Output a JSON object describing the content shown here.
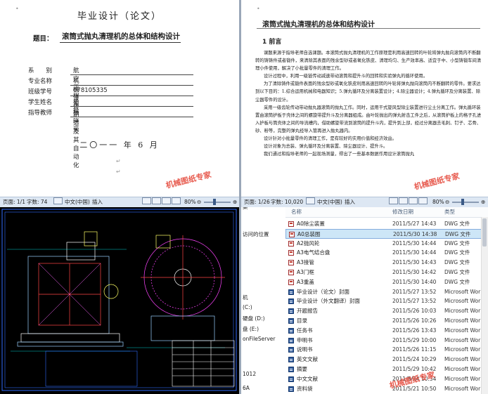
{
  "watermark": "机械图纸专家",
  "cover": {
    "title": "毕业设计（论文）",
    "topic_label": "题目：",
    "topic": "滚筒式抛丸清理机的总体和结构设计",
    "rows": [
      {
        "label": "系　　别",
        "value": "航空工程系"
      },
      {
        "label": "专业名称",
        "value": "机械设计制造及其自动化"
      },
      {
        "label": "班级学号",
        "value": "078105335"
      },
      {
        "label": "学生姓名",
        "value": "杨挺"
      },
      {
        "label": "指导教师",
        "value": "张晓荣"
      }
    ],
    "date": "二〇一一 年 6 月",
    "status": {
      "page": "页面: 1/1",
      "words": "字数: 74",
      "lang": "中文(中国)",
      "mode": "插入",
      "zoom": "80%"
    }
  },
  "doc": {
    "title": "滚筒式抛丸清理机的总体和结构设计",
    "heading": "1  前言",
    "paragraphs": [
      "课题来源于指导老师自选课题。本滚筒式抛丸清理机的工作原理是利用高速回转的叶轮将弹丸抛向滚筒内不断翻转的铸铸件或者锻件，来清除其表面的残余型砂或者氧化铁皮、清理均匀、生产效率高、适宜于中、小型铸锻车间清理小件使用，解决了小批量零件的清理工作。",
      "设计过程中，利用一级链传动减速带动滚筒和提升斗的回转和实验弹丸的循环使用。",
      "为了清除铸件或锻件表面的残余型砂或氧化铁皮利用高速回转的叶轮将弹丸抛向滚筒内不断翻转的零件。要求达到以下目的：1.综合运用机械和电器知识；5.弹丸循环及分离装置设计；4.除尘器设计；4.弹丸循环及分离装置、除尘器零件的设计。",
      "采用一级齿轮传动带动抛丸器滚筒的抛丸工作。同时，运用干式旋风型除尘装置进行尘土分离工作。弹丸循环装置由滚筒护板于壳体之间的螺旋带提升斗及分离器组成。由叶轮抛出的弹丸射击工件之后，从滚筒护板上的格子孔进入护板与筒壳体之间的导流槽内，借助螺旋带流到滚筒的提升斗内，提升到上部，经过分离器去毛刺、钉子、芯骨、砂、粉等，完整的弹丸经导入管再进入抛丸器内。",
      "设计针对小批量零件的清理工作，是有较好的实用价值和经济效益。",
      "设计对象为总装、弹丸循环及分离装置、除尘器设计、提升斗。",
      "我们通过和指导老师的一起现场测量，得出了一些基本数据作用设计滚筒抛丸"
    ],
    "status": {
      "page": "页面: 1/26",
      "words": "字数: 10,020",
      "lang": "中文(中国)",
      "mode": "插入",
      "zoom": "80%"
    }
  },
  "cad": {
    "status": {
      "page": "页面: 1/1",
      "words": "字数: 74",
      "lang": "中文(中国)",
      "mode": "插入",
      "zoom": "80%"
    }
  },
  "explorer": {
    "nav_items": [
      "集",
      "访问的位置",
      "",
      "",
      "",
      "",
      "",
      "",
      "",
      "机",
      "(C:)",
      "硬盘 (D:)",
      "盘 (E:)",
      "onFileServer",
      "",
      "1012",
      "6A"
    ],
    "columns": {
      "name": "名称",
      "date": "修改日期",
      "type": "类型"
    },
    "files": [
      {
        "name": "A0除尘装置",
        "date": "2011/5/27 14:43",
        "type": "DWG 文件",
        "icon": "dwg",
        "selected": false
      },
      {
        "name": "A0总装图",
        "date": "2011/5/30 14:38",
        "type": "DWG 文件",
        "icon": "dwg",
        "selected": true
      },
      {
        "name": "A2抛风轮",
        "date": "2011/5/30 14:44",
        "type": "DWG 文件",
        "icon": "dwg",
        "selected": false
      },
      {
        "name": "A3电气结合盘",
        "date": "2011/5/30 14:44",
        "type": "DWG 文件",
        "icon": "dwg",
        "selected": false
      },
      {
        "name": "A3接管",
        "date": "2011/5/30 14:43",
        "type": "DWG 文件",
        "icon": "dwg",
        "selected": false
      },
      {
        "name": "A3门框",
        "date": "2011/5/30 14:42",
        "type": "DWG 文件",
        "icon": "dwg",
        "selected": false
      },
      {
        "name": "A3重盖",
        "date": "2011/5/30 14:40",
        "type": "DWG 文件",
        "icon": "dwg",
        "selected": false
      },
      {
        "name": "毕业设计（论文）封面",
        "date": "2011/5/27 13:52",
        "type": "Microsoft Wor",
        "icon": "doc",
        "selected": false
      },
      {
        "name": "毕业设计（外文翻译）封面",
        "date": "2011/5/27 13:52",
        "type": "Microsoft Wor",
        "icon": "doc",
        "selected": false
      },
      {
        "name": "开题报告",
        "date": "2011/5/26 10:03",
        "type": "Microsoft Wor",
        "icon": "doc",
        "selected": false
      },
      {
        "name": "目录",
        "date": "2011/5/26 10:26",
        "type": "Microsoft Wor",
        "icon": "doc",
        "selected": false
      },
      {
        "name": "任务书",
        "date": "2011/5/26 13:43",
        "type": "Microsoft Wor",
        "icon": "doc",
        "selected": false
      },
      {
        "name": "申明书",
        "date": "2011/5/29 10:00",
        "type": "Microsoft Wor",
        "icon": "doc",
        "selected": false
      },
      {
        "name": "说明书",
        "date": "2011/5/26 11:15",
        "type": "Microsoft Wor",
        "icon": "doc",
        "selected": false
      },
      {
        "name": "英文文献",
        "date": "2011/5/24 10:29",
        "type": "Microsoft Wor",
        "icon": "doc",
        "selected": false
      },
      {
        "name": "摘要",
        "date": "2011/5/29 10:42",
        "type": "Microsoft Wor",
        "icon": "doc",
        "selected": false
      },
      {
        "name": "中文文献",
        "date": "2011/5/24 10:34",
        "type": "Microsoft Wor",
        "icon": "doc",
        "selected": false
      },
      {
        "name": "资料袋",
        "date": "2011/5/21 10:50",
        "type": "Microsoft Wor",
        "icon": "doc",
        "selected": false
      }
    ]
  }
}
